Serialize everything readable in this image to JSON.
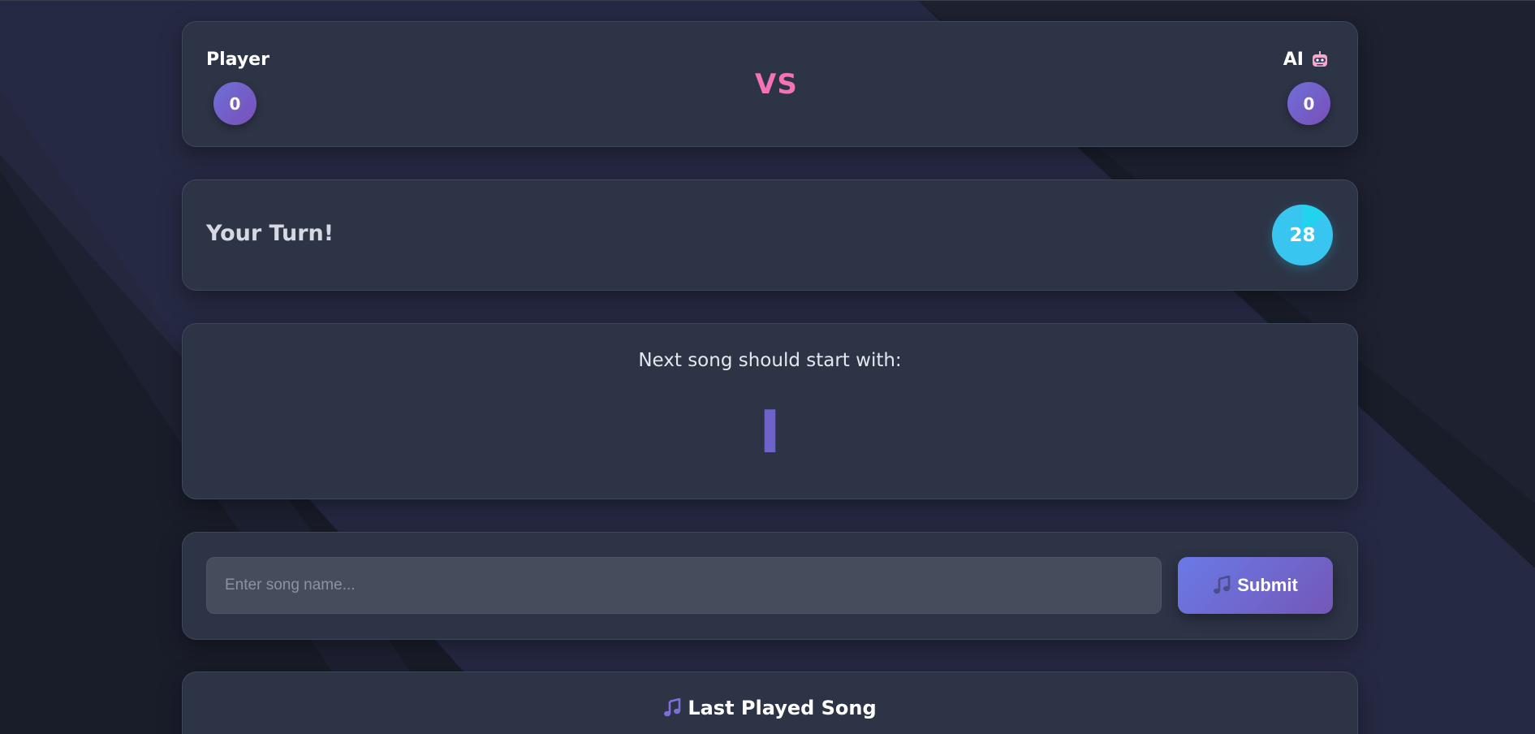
{
  "scoreboard": {
    "player_label": "Player",
    "player_score": "0",
    "vs_label": "VS",
    "ai_label": "AI",
    "ai_score": "0"
  },
  "turn": {
    "label": "Your Turn!",
    "timer": "28"
  },
  "next_song": {
    "label": "Next song should start with:",
    "letter": "I"
  },
  "song_input": {
    "placeholder": "Enter song name...",
    "value": ""
  },
  "submit": {
    "label": "Submit",
    "icon": "music-note-icon"
  },
  "last_played": {
    "title": "Last Played Song",
    "icon": "music-note-icon"
  },
  "colors": {
    "accent": "#6e6fd8",
    "vs": "#f472b6",
    "timer": "#22d3ee",
    "card": "#2d3446",
    "background": "#191d29"
  }
}
